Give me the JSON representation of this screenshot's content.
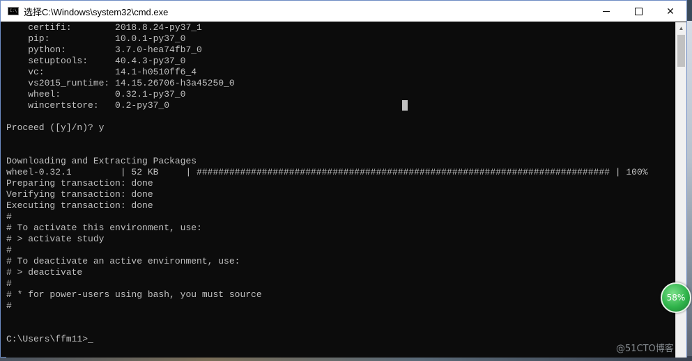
{
  "window": {
    "title": "选择C:\\Windows\\system32\\cmd.exe",
    "icon_text": "C:\\"
  },
  "console": {
    "lines": [
      "    certifi:        2018.8.24-py37_1",
      "    pip:            10.0.1-py37_0",
      "    python:         3.7.0-hea74fb7_0",
      "    setuptools:     40.4.3-py37_0",
      "    vc:             14.1-h0510ff6_4",
      "    vs2015_runtime: 14.15.26706-h3a45250_0",
      "    wheel:          0.32.1-py37_0",
      "    wincertstore:   0.2-py37_0",
      "",
      "Proceed ([y]/n)? y",
      "",
      "",
      "Downloading and Extracting Packages",
      "wheel-0.32.1         | 52 KB     | ############################################################################ | 100%",
      "Preparing transaction: done",
      "Verifying transaction: done",
      "Executing transaction: done",
      "#",
      "# To activate this environment, use:",
      "# > activate study",
      "#",
      "# To deactivate an active environment, use:",
      "# > deactivate",
      "#",
      "# * for power-users using bash, you must source",
      "#",
      "",
      "",
      "C:\\Users\\ffm11>_"
    ]
  },
  "overlay": {
    "gauge_value": "58%",
    "gauge_color": "#2fb34a",
    "watermark": "@51CTO博客"
  },
  "colors": {
    "console_bg": "#0c0c0c",
    "console_fg": "#c0c0c0",
    "titlebar_bg": "#ffffff"
  }
}
